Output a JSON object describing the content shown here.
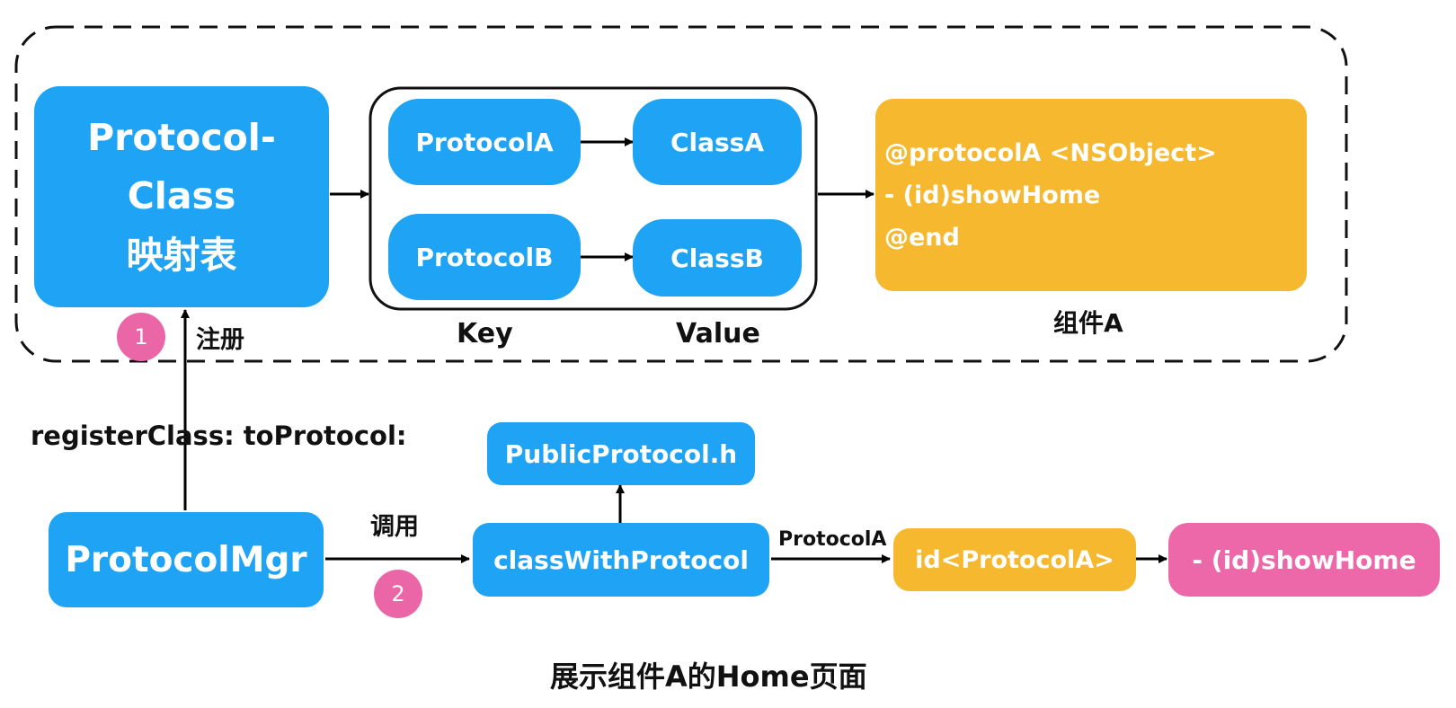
{
  "mapping_table": {
    "line1": "Protocol-Class",
    "line2": "映射表"
  },
  "pairs": {
    "protocol_a": "ProtocolA",
    "class_a": "ClassA",
    "protocol_b": "ProtocolB",
    "class_b": "ClassB",
    "key_label": "Key",
    "value_label": "Value"
  },
  "component_a": {
    "line1": "@protocolA  <NSObject>",
    "line2": "- (id)showHome",
    "line3": "@end",
    "caption": "组件A"
  },
  "register": {
    "badge": "1",
    "label": "注册",
    "method": "registerClass: toProtocol:"
  },
  "protocol_mgr": "ProtocolMgr",
  "invoke": {
    "label": "调用",
    "badge": "2"
  },
  "public_protocol": "PublicProtocol.h",
  "class_with_protocol": "classWithProtocol",
  "protocol_a_edge_label": "ProtocolA",
  "id_protocol_a": "id<ProtocolA>",
  "show_home": "- (id)showHome",
  "footer_caption": "展示组件A的Home页面",
  "colors": {
    "blue": "#1fa3f5",
    "orange": "#f5b82e",
    "pink": "#ec68a8"
  }
}
